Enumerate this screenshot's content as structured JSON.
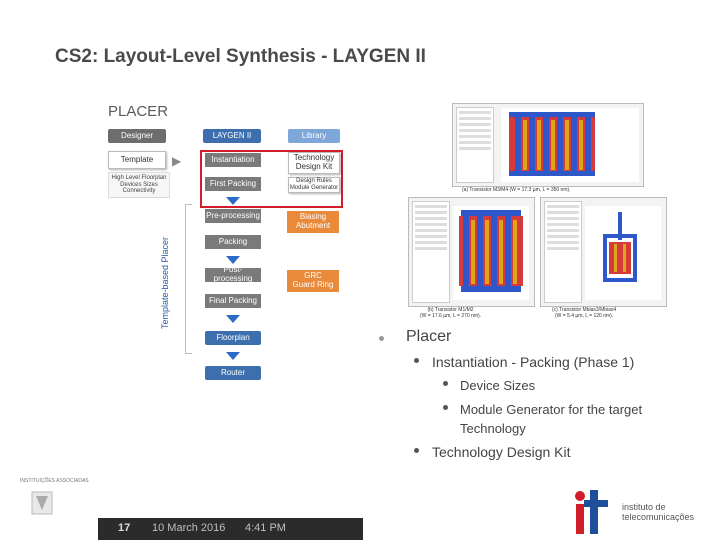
{
  "slide": {
    "title": "CS2: Layout-Level Synthesis - LAYGEN II",
    "section_label": "PLACER"
  },
  "diagram": {
    "side_label": "Template-based Placer",
    "col_designer": "Designer",
    "col_laygen": "LAYGEN II",
    "col_library": "Library",
    "template": "Template",
    "template_desc": "High Level Floorplan\nDevices Sizes\nConnectivity",
    "instantiation": "Instantiation",
    "tech_kit": "Technology\nDesign Kit",
    "first_packing": "First Packing",
    "design_rules": "Design Rules\nModule Generator",
    "preprocessing": "Pre-processing",
    "biasing": "Biasing\nAbutment",
    "packing": "Packing",
    "postprocessing": "Post-processing",
    "grc": "GRC\nGuard Ring",
    "final_packing": "Final Packing",
    "floorplan": "Floorplan",
    "router": "Router"
  },
  "figures": {
    "caption_a": "(a) Transistor M3/M4 (W = 17.3 µm, L = 350 nm).",
    "caption_b": "(b) Transistor M1/M2\n(W = 17.6 µm, L = 270 nm).",
    "caption_c": "(c) Transistor Mbias3/Mbias4\n(W = 5.4 µm, L = 120 nm)."
  },
  "bullets": {
    "l1": "Placer",
    "l2a": "Instantiation - Packing (Phase 1)",
    "l3a": "Device Sizes",
    "l3b": "Module Generator for the target",
    "l3b_cont": "Technology",
    "l2b": "Technology Design Kit"
  },
  "logos": {
    "inst_small": "INSTITUIÇÕES ASSOCIADAS",
    "it_name": "instituto de\ntelecomunicações"
  },
  "footer": {
    "page": "17",
    "date": "10 March 2016",
    "time": "4:41 PM"
  },
  "colors": {
    "accent_blue": "#2b6bc8",
    "highlight_red": "#d21e2a",
    "footer_bar": "#2b2b2b"
  }
}
